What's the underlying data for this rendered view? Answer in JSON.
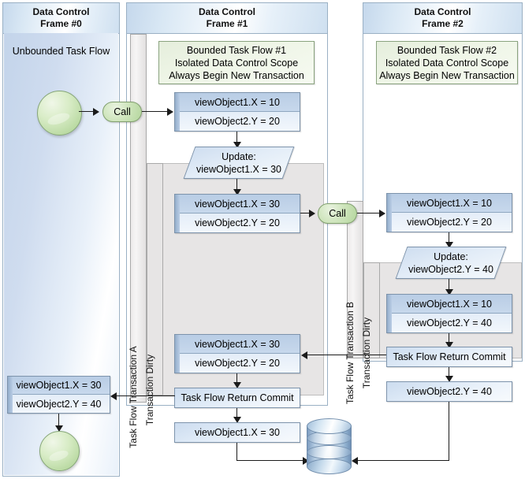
{
  "frames": [
    {
      "id": "frame0",
      "title": "Data Control\nFrame #0",
      "line1": "Data Control",
      "line2": "Frame #0",
      "subtitle": "Unbounded Task Flow"
    },
    {
      "id": "frame1",
      "title": "Data Control\nFrame #1",
      "line1": "Data Control",
      "line2": "Frame #1"
    },
    {
      "id": "frame2",
      "title": "Data Control\nFrame #2",
      "line1": "Data Control",
      "line2": "Frame #2"
    }
  ],
  "taskflow1": {
    "l1": "Bounded Task Flow #1",
    "l2": "Isolated Data Control Scope",
    "l3": "Always Begin New Transaction"
  },
  "taskflow2": {
    "l1": "Bounded Task Flow #2",
    "l2": "Isolated Data Control Scope",
    "l3": "Always Begin New Transaction"
  },
  "bands": {
    "transaction_a": "Task Flow Transaction A",
    "dirty_a": "Transaction Dirty",
    "transaction_b": "Task Flow Transaction B",
    "dirty_b": "Transaction Dirty"
  },
  "calls": {
    "call1": "Call",
    "call2": "Call"
  },
  "f1_state1": {
    "row1": "viewObject1.X = 10",
    "row2": "viewObject2.Y = 20"
  },
  "f1_update": {
    "l1": "Update:",
    "l2": "viewObject1.X = 30"
  },
  "f1_state2": {
    "row1": "viewObject1.X = 30",
    "row2": "viewObject2.Y = 20"
  },
  "f1_state3": {
    "row1": "viewObject1.X = 30",
    "row2": "viewObject2.Y = 20"
  },
  "f1_commit": "Task Flow Return Commit",
  "f1_final": "viewObject1.X = 30",
  "f2_state1": {
    "row1": "viewObject1.X = 10",
    "row2": "viewObject2.Y = 20"
  },
  "f2_update": {
    "l1": "Update:",
    "l2": "viewObject2.Y = 40"
  },
  "f2_state2": {
    "row1": "viewObject1.X = 10",
    "row2": "viewObject2.Y = 40"
  },
  "f2_commit": "Task Flow Return Commit",
  "f2_final": "viewObject2.Y = 40",
  "f0_state": {
    "row1": "viewObject1.X = 30",
    "row2": "viewObject2.Y = 40"
  },
  "icons": {
    "start": "start-circle-icon",
    "end": "end-circle-icon",
    "database": "database-cylinder-icon"
  },
  "colors": {
    "frame_border": "#9ab0c4",
    "header_blue": "#cfe0f0",
    "node_blue": "#ccdcef",
    "taskflow_green": "#eef5e6",
    "call_green": "#b4d69d",
    "dirty_gray": "#e7e5e5",
    "line": "#1b1b1b"
  }
}
